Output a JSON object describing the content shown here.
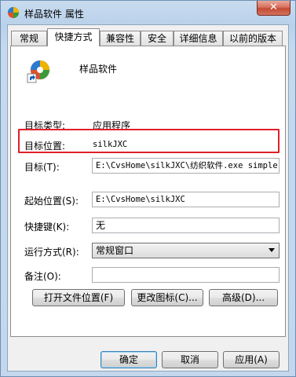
{
  "window": {
    "title": "样品软件 属性",
    "close_label": "✕"
  },
  "tabs": [
    {
      "label": "常规",
      "active": false
    },
    {
      "label": "快捷方式",
      "active": true
    },
    {
      "label": "兼容性",
      "active": false
    },
    {
      "label": "安全",
      "active": false
    },
    {
      "label": "详细信息",
      "active": false
    },
    {
      "label": "以前的版本",
      "active": false
    }
  ],
  "shortcut": {
    "name": "样品软件",
    "target_type_label": "目标类型:",
    "target_type_value": "应用程序",
    "target_location_label": "目标位置:",
    "target_location_value": "silkJXC",
    "target_label": "目标(T):",
    "target_value": "E:\\CvsHome\\silkJXC\\纺织软件.exe simple",
    "start_in_label": "起始位置(S):",
    "start_in_value": "E:\\CvsHome\\silkJXC",
    "hotkey_label": "快捷键(K):",
    "hotkey_value": "无",
    "run_label": "运行方式(R):",
    "run_value": "常规窗口",
    "comment_label": "备注(O):",
    "comment_value": "",
    "open_location_button": "打开文件位置(F)",
    "change_icon_button": "更改图标(C)...",
    "advanced_button": "高级(D)..."
  },
  "footer": {
    "ok": "确定",
    "cancel": "取消",
    "apply": "应用(A)"
  },
  "colors": {
    "highlight": "#e0202a",
    "frame": "#c4d7ec"
  },
  "icons": {
    "app_icon": "colorful-pinwheel-icon",
    "shortcut_overlay": "shortcut-arrow-icon"
  }
}
